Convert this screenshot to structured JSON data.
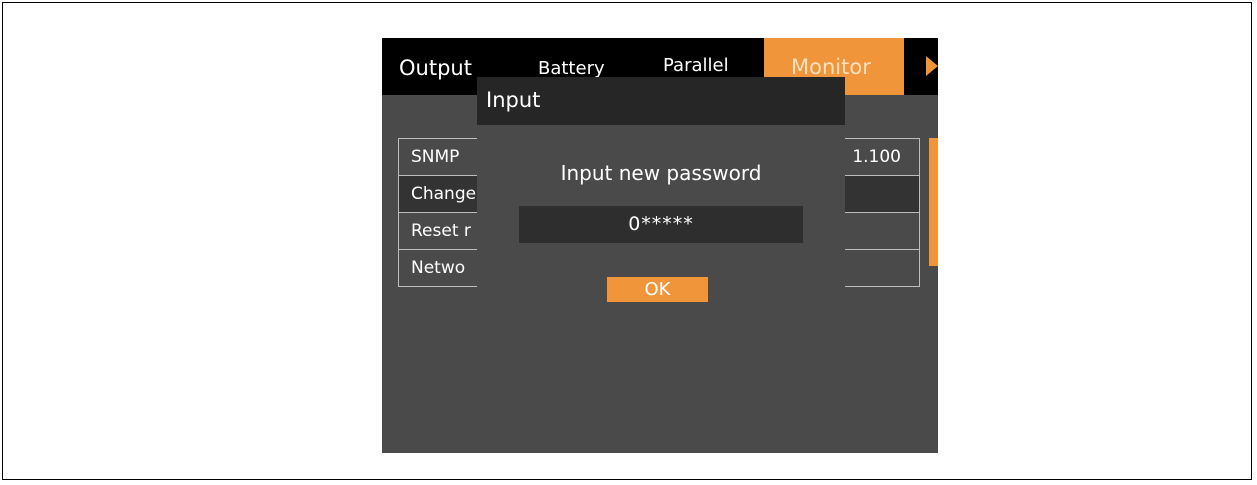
{
  "tabs": [
    {
      "label": "Output"
    },
    {
      "label": "Battery"
    },
    {
      "label": "Parallel"
    },
    {
      "label": "Monitor",
      "active": true
    }
  ],
  "next_tab_icon": "triangle-right",
  "list": {
    "rows": [
      {
        "label": "SNMP",
        "value": "1.100"
      },
      {
        "label": "Change",
        "value": ""
      },
      {
        "label": "Reset r",
        "value": ""
      },
      {
        "label": "Netwo",
        "value": ""
      }
    ]
  },
  "dialog": {
    "title": "Input",
    "prompt": "Input new password",
    "password_value": "0*****",
    "ok_label": "OK"
  },
  "colors": {
    "accent": "#f0953a",
    "screen_bg": "#4a4a4a",
    "tabbar_bg": "#000000",
    "dialog_header_bg": "#262626",
    "field_bg": "#2e2e2e"
  }
}
